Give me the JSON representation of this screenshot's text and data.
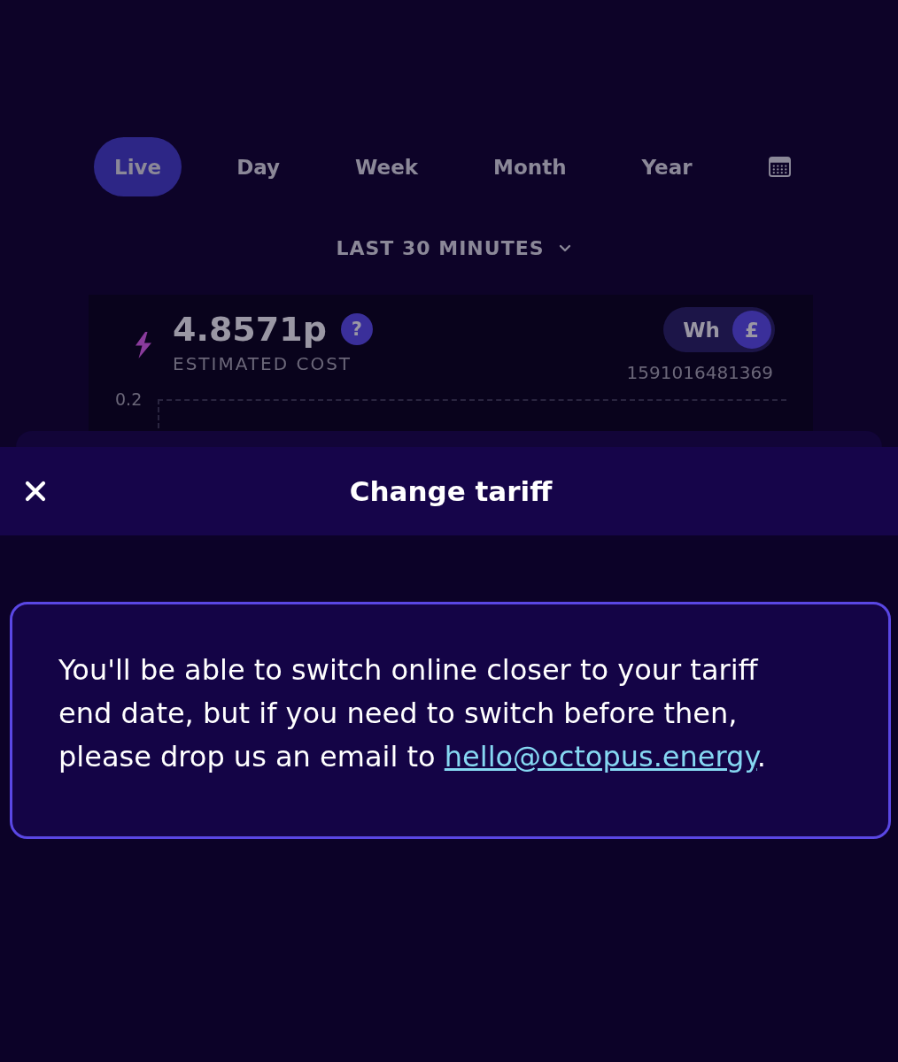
{
  "tabs": [
    {
      "label": "Live",
      "selected": true
    },
    {
      "label": "Day",
      "selected": false
    },
    {
      "label": "Week",
      "selected": false
    },
    {
      "label": "Month",
      "selected": false
    },
    {
      "label": "Year",
      "selected": false
    }
  ],
  "period": {
    "label": "LAST 30 MINUTES"
  },
  "summary": {
    "value": "4.8571p",
    "help": "?",
    "label": "ESTIMATED COST",
    "units": [
      {
        "label": "Wh",
        "selected": false
      },
      {
        "label": "£",
        "selected": true
      }
    ],
    "meter_id": "1591016481369",
    "y_tick": "0.2"
  },
  "sheet": {
    "title": "Change tariff",
    "message": "You'll be able to switch online closer to your tariff end date, but if you need to switch before then, please drop us an email to",
    "email": "hello@octopus.energy",
    "message_end": "."
  }
}
